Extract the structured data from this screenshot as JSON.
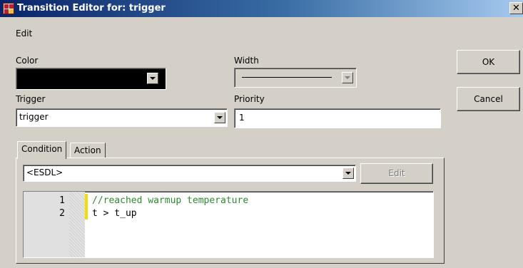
{
  "window": {
    "title": "Transition Editor for: trigger",
    "close_glyph": "✕"
  },
  "menu": {
    "edit_label": "Edit"
  },
  "color": {
    "label": "Color",
    "value": "#000000"
  },
  "width": {
    "label": "Width"
  },
  "trigger": {
    "label": "Trigger",
    "value": "trigger"
  },
  "priority": {
    "label": "Priority",
    "value": "1"
  },
  "buttons": {
    "ok_label": "OK",
    "cancel_label": "Cancel"
  },
  "tabs": [
    {
      "label": "Condition",
      "active": true
    },
    {
      "label": "Action",
      "active": false
    }
  ],
  "condition": {
    "language": "<ESDL>",
    "edit_label": "Edit",
    "lines": [
      {
        "number": "1",
        "text": "//reached warmup temperature",
        "kind": "comment"
      },
      {
        "number": "2",
        "text": "t > t_up",
        "kind": "code"
      }
    ]
  },
  "icons": [
    "state-machine-icon",
    "close-icon",
    "chevron-down-icon"
  ],
  "colors": {
    "comment": "#2e8b2e",
    "change_bar": "#f0e000",
    "dialog_bg": "#d4d0c8"
  }
}
